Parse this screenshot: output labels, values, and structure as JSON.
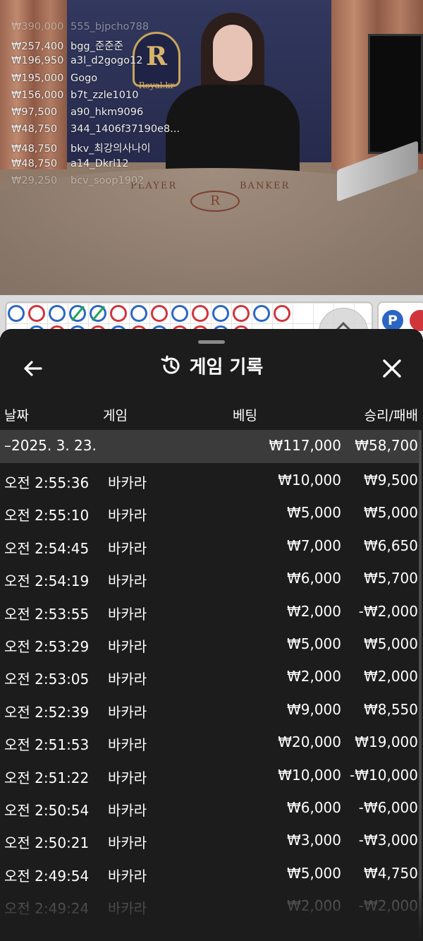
{
  "video": {
    "emblem_letter": "R",
    "emblem_text": "Royal.kr",
    "table_left_label": "PLAYER",
    "table_right_label": "BANKER",
    "table_logo": "R",
    "recent_bets": [
      {
        "amount": "₩390,000",
        "user": "555_bjpcho788"
      },
      {
        "amount": "₩257,400",
        "user": "bgg_준준준"
      },
      {
        "amount": "₩196,950",
        "user": "a3l_d2gogo12"
      },
      {
        "amount": "₩195,000",
        "user": "Gogo"
      },
      {
        "amount": "₩156,000",
        "user": "b7t_zzle1010"
      },
      {
        "amount": "₩97,500",
        "user": "a90_hkm9096"
      },
      {
        "amount": "₩48,750",
        "user": "344_1406f37190e8..."
      },
      {
        "amount": "₩48,750",
        "user": "bkv_최강의사나이"
      },
      {
        "amount": "₩48,750",
        "user": "a14_Dkrl12"
      },
      {
        "amount": "₩29,250",
        "user": "bcv_soop1902"
      }
    ]
  },
  "roadmap": {
    "beads": [
      "blue",
      "red",
      "blue",
      "tie",
      "tie",
      "red",
      "blue",
      "red",
      "blue",
      "red",
      "blue",
      "red",
      "blue",
      "red"
    ],
    "player_badge": "P",
    "colors": {
      "player": "#2b66c4",
      "banker": "#d0353c",
      "tie": "#1fa64f"
    }
  },
  "history": {
    "title": "게임 기록",
    "icons": {
      "back": "arrow-left-icon",
      "title": "history-icon",
      "close": "close-icon"
    },
    "columns": {
      "date": "날짜",
      "game": "게임",
      "bet": "베팅",
      "result": "승리/패배"
    },
    "date_group": {
      "label": "–2025. 3. 23.",
      "total_bet": "₩117,000",
      "total_result": "₩58,700"
    },
    "rows": [
      {
        "time": "오전 2:55:36",
        "game": "바카라",
        "bet": "₩10,000",
        "result": "₩9,500"
      },
      {
        "time": "오전 2:55:10",
        "game": "바카라",
        "bet": "₩5,000",
        "result": "₩5,000"
      },
      {
        "time": "오전 2:54:45",
        "game": "바카라",
        "bet": "₩7,000",
        "result": "₩6,650"
      },
      {
        "time": "오전 2:54:19",
        "game": "바카라",
        "bet": "₩6,000",
        "result": "₩5,700"
      },
      {
        "time": "오전 2:53:55",
        "game": "바카라",
        "bet": "₩2,000",
        "result": "-₩2,000"
      },
      {
        "time": "오전 2:53:29",
        "game": "바카라",
        "bet": "₩5,000",
        "result": "₩5,000"
      },
      {
        "time": "오전 2:53:05",
        "game": "바카라",
        "bet": "₩2,000",
        "result": "₩2,000"
      },
      {
        "time": "오전 2:52:39",
        "game": "바카라",
        "bet": "₩9,000",
        "result": "₩8,550"
      },
      {
        "time": "오전 2:51:53",
        "game": "바카라",
        "bet": "₩20,000",
        "result": "₩19,000"
      },
      {
        "time": "오전 2:51:22",
        "game": "바카라",
        "bet": "₩10,000",
        "result": "-₩10,000"
      },
      {
        "time": "오전 2:50:54",
        "game": "바카라",
        "bet": "₩6,000",
        "result": "-₩6,000"
      },
      {
        "time": "오전 2:50:21",
        "game": "바카라",
        "bet": "₩3,000",
        "result": "-₩3,000"
      },
      {
        "time": "오전 2:49:54",
        "game": "바카라",
        "bet": "₩5,000",
        "result": "₩4,750"
      },
      {
        "time": "오전 2:49:24",
        "game": "바카라",
        "bet": "₩2,000",
        "result": "-₩2,000"
      }
    ]
  }
}
